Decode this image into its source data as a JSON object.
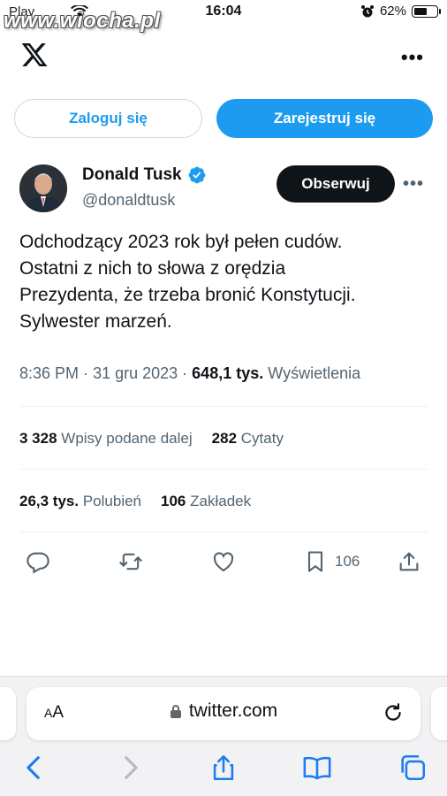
{
  "status_bar": {
    "carrier": "Play",
    "time": "16:04",
    "battery": "62%",
    "battery_level": 0.62
  },
  "watermark": "www.wiocha.pl",
  "header": {
    "logo": "x-logo-icon",
    "more": "more-icon"
  },
  "auth": {
    "login_label": "Zaloguj się",
    "signup_label": "Zarejestruj się"
  },
  "author": {
    "name": "Donald Tusk",
    "handle": "@donaldtusk",
    "follow_label": "Obserwuj",
    "verified_icon": "verified-badge-icon"
  },
  "tweet": {
    "lines": [
      "Odchodzący 2023 rok był pełen cudów.",
      "Ostatni z nich to słowa z orędzia",
      "Prezydenta, że trzeba bronić Konstytucji.",
      "Sylwester marzeń."
    ],
    "time": "8:36 PM",
    "date": "31 gru 2023",
    "views_count": "648,1 tys.",
    "views_label": "Wyświetlenia"
  },
  "stats": {
    "reposts_count": "3 328",
    "reposts_label": "Wpisy podane dalej",
    "quotes_count": "282",
    "quotes_label": "Cytaty",
    "likes_count": "26,3 tys.",
    "likes_label": "Polubień",
    "bookmarks_count": "106",
    "bookmarks_label": "Zakładek"
  },
  "actions": {
    "bookmark_count": "106"
  },
  "browser": {
    "aa_label": "AA",
    "url": "twitter.com"
  },
  "colors": {
    "accent": "#1d9bf0",
    "text": "#0f1419",
    "muted": "#536471"
  }
}
